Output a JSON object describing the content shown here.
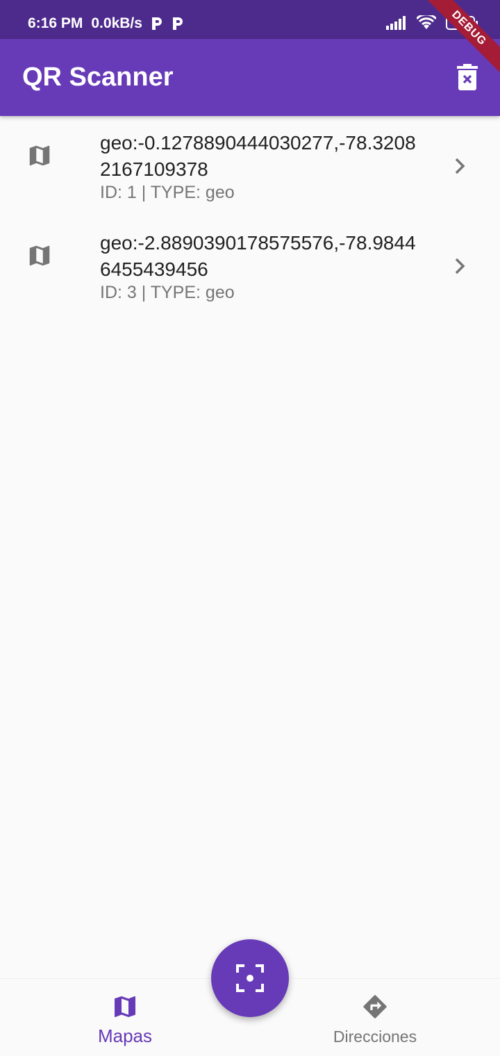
{
  "status_bar": {
    "time": "6:16 PM",
    "speed": "0.0kB/s",
    "battery": "11"
  },
  "debug_banner": "DEBUG",
  "app_bar": {
    "title": "QR Scanner",
    "delete_icon": "delete-sweep-icon"
  },
  "scans": [
    {
      "title": "geo:-0.1278890444030277,-78.32082167109378",
      "subtitle": "ID: 1 | TYPE: geo",
      "icon": "map-icon"
    },
    {
      "title": "geo:-2.8890390178575576,-78.98446455439456",
      "subtitle": "ID: 3 | TYPE: geo",
      "icon": "map-icon"
    }
  ],
  "bottom_nav": {
    "items": [
      {
        "label": "Mapas",
        "icon": "map-icon",
        "active": true
      },
      {
        "label": "Direcciones",
        "icon": "directions-icon",
        "active": false
      }
    ]
  },
  "fab": {
    "icon": "center-focus-icon"
  },
  "colors": {
    "primary": "#673ab7",
    "status_bar": "#4d2b8c",
    "debug_ribbon": "#a51c36",
    "icon_gray": "#757575"
  }
}
